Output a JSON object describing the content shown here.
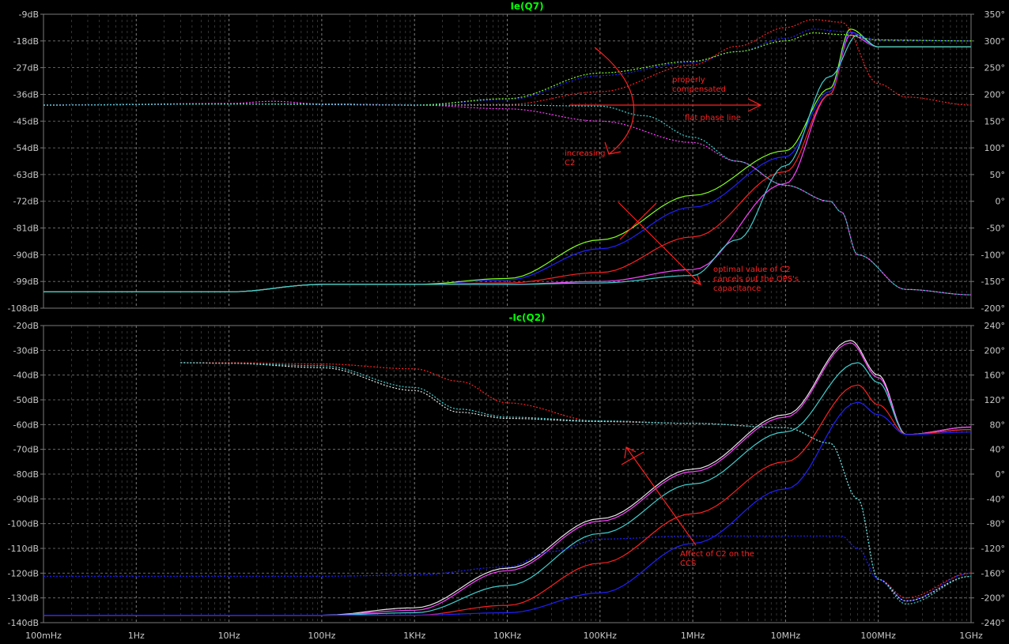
{
  "colors": {
    "background": "#000000",
    "grid": "#7a7a7a",
    "axis_text": "#c8c8c8",
    "title": "#00ff00",
    "annotation": "#ff2020",
    "magenta": "#ff40ff",
    "white": "#e8e8e8",
    "cyan": "#40d0d0",
    "red": "#ff2020",
    "blue": "#2020ff",
    "green": "#80ff20",
    "yellow": "#e8e830"
  },
  "x_axis": {
    "type": "log",
    "range_hz": [
      0.1,
      1000000000
    ],
    "tick_labels": [
      "100mHz",
      "1Hz",
      "10Hz",
      "100Hz",
      "1KHz",
      "10KHz",
      "100KHz",
      "1MHz",
      "10MHz",
      "100MHz",
      "1GHz"
    ]
  },
  "chart_data": [
    {
      "type": "line",
      "title": "Ie(Q7)",
      "x_scale": "log",
      "ylim_db": [
        -108,
        -9
      ],
      "ylim_deg": [
        -200,
        350
      ],
      "y_left_ticks": [
        "-9dB",
        "-18dB",
        "-27dB",
        "-36dB",
        "-45dB",
        "-54dB",
        "-63dB",
        "-72dB",
        "-81dB",
        "-90dB",
        "-99dB",
        "-108dB"
      ],
      "y_right_ticks": [
        "350°",
        "300°",
        "250°",
        "200°",
        "150°",
        "100°",
        "50°",
        "0°",
        "-50°",
        "-100°",
        "-150°",
        "-200°"
      ],
      "grid": true,
      "series": [
        {
          "color": "magenta",
          "kind": "magnitude",
          "x": [
            0.1,
            10,
            100,
            1000,
            10000,
            100000,
            1000000,
            10000000,
            30000000,
            50000000,
            100000000,
            1000000000
          ],
          "y": [
            -102.5,
            -102.5,
            -100,
            -100,
            -100,
            -99,
            -95,
            -66,
            -36,
            -16,
            -20,
            -20
          ]
        },
        {
          "color": "red",
          "kind": "magnitude",
          "x": [
            0.1,
            10,
            100,
            1000,
            10000,
            100000,
            1000000,
            10000000,
            30000000,
            50000000,
            100000000,
            1000000000
          ],
          "y": [
            -102.5,
            -102.5,
            -100,
            -100,
            -99.5,
            -96,
            -84,
            -62,
            -36,
            -15,
            -20,
            -20
          ]
        },
        {
          "color": "blue",
          "kind": "magnitude",
          "x": [
            0.1,
            10,
            100,
            1000,
            10000,
            100000,
            1000000,
            10000000,
            30000000,
            50000000,
            100000000,
            1000000000
          ],
          "y": [
            -102.5,
            -102.5,
            -100,
            -100,
            -98.5,
            -88,
            -74,
            -57,
            -35,
            -15,
            -20,
            -20
          ]
        },
        {
          "color": "green",
          "kind": "magnitude",
          "x": [
            0.1,
            10,
            100,
            1000,
            10000,
            100000,
            1000000,
            10000000,
            30000000,
            50000000,
            100000000,
            1000000000
          ],
          "y": [
            -102.5,
            -102.5,
            -100,
            -100,
            -98,
            -85,
            -70,
            -55,
            -34,
            -14,
            -20,
            -20
          ]
        },
        {
          "color": "cyan",
          "kind": "magnitude",
          "x": [
            0.1,
            10,
            100,
            1000,
            10000,
            100000,
            1000000,
            3000000,
            10000000,
            30000000,
            60000000,
            100000000,
            1000000000
          ],
          "y": [
            -102.5,
            -102.5,
            -100,
            -100,
            -100,
            -99.5,
            -97,
            -85,
            -60,
            -30,
            -16,
            -20,
            -20
          ]
        },
        {
          "color": "red",
          "kind": "phase",
          "x": [
            0.1,
            10,
            100,
            1000,
            10000,
            100000,
            1000000,
            3000000,
            10000000,
            20000000,
            40000000,
            100000000,
            200000000,
            1000000000
          ],
          "y": [
            180,
            182,
            182,
            180,
            181,
            205,
            255,
            290,
            325,
            340,
            335,
            220,
            195,
            180
          ]
        },
        {
          "color": "blue",
          "kind": "phase",
          "x": [
            0.1,
            10,
            100,
            1000,
            10000,
            100000,
            1000000,
            3000000,
            10000000,
            20000000,
            40000000,
            100000000,
            1000000000
          ],
          "y": [
            180,
            182,
            182,
            180,
            190,
            235,
            260,
            280,
            305,
            322,
            318,
            302,
            300
          ]
        },
        {
          "color": "green",
          "kind": "phase",
          "x": [
            0.1,
            10,
            100,
            1000,
            10000,
            100000,
            1000000,
            3000000,
            10000000,
            20000000,
            40000000,
            100000000,
            1000000000
          ],
          "y": [
            180,
            182,
            182,
            180,
            192,
            240,
            262,
            280,
            300,
            315,
            312,
            302,
            300
          ]
        },
        {
          "color": "magenta",
          "kind": "phase",
          "x": [
            0.1,
            10,
            30,
            100,
            1000,
            10000,
            100000,
            1000000,
            3000000,
            10000000,
            30000000,
            40000000,
            60000000,
            200000000,
            1000000000
          ],
          "y": [
            180,
            183,
            187,
            182,
            180,
            173,
            150,
            110,
            75,
            30,
            0,
            -20,
            -100,
            -165,
            -175
          ]
        },
        {
          "color": "cyan",
          "kind": "phase",
          "x": [
            0.1,
            10,
            1000,
            10000,
            100000,
            300000,
            1000000,
            3000000,
            10000000,
            30000000,
            40000000,
            60000000,
            200000000,
            1000000000
          ],
          "y": [
            180,
            182,
            180,
            180,
            178,
            160,
            120,
            75,
            30,
            0,
            -20,
            -100,
            -165,
            -175
          ]
        }
      ],
      "annotations": [
        "properly\ncompensated",
        "flat phase line",
        "increasing\nC2",
        "optimal value of C2\ncancels out the OPS's\ncapacitance"
      ]
    },
    {
      "type": "line",
      "title": "-Ic(Q2)",
      "x_scale": "log",
      "ylim_db": [
        -140,
        -20
      ],
      "ylim_deg": [
        -240,
        240
      ],
      "y_left_ticks": [
        "-20dB",
        "-30dB",
        "-40dB",
        "-50dB",
        "-60dB",
        "-70dB",
        "-80dB",
        "-90dB",
        "-100dB",
        "-110dB",
        "-120dB",
        "-130dB",
        "-140dB"
      ],
      "y_right_ticks": [
        "240°",
        "200°",
        "160°",
        "120°",
        "80°",
        "40°",
        "0°",
        "-40°",
        "-80°",
        "-120°",
        "-160°",
        "-200°",
        "-240°"
      ],
      "grid": true,
      "series": [
        {
          "color": "white",
          "kind": "magnitude",
          "x": [
            0.1,
            100,
            1000,
            10000,
            100000,
            1000000,
            10000000,
            50000000,
            100000000,
            200000000,
            1000000000
          ],
          "y": [
            -137,
            -137,
            -134,
            -118,
            -98,
            -78,
            -56,
            -26,
            -40,
            -64,
            -61
          ]
        },
        {
          "color": "magenta",
          "kind": "magnitude",
          "x": [
            0.1,
            100,
            1000,
            10000,
            100000,
            1000000,
            10000000,
            50000000,
            100000000,
            200000000,
            1000000000
          ],
          "y": [
            -137,
            -137,
            -135,
            -119,
            -99,
            -79,
            -57,
            -27,
            -41,
            -64,
            -61
          ]
        },
        {
          "color": "cyan",
          "kind": "magnitude",
          "x": [
            0.1,
            100,
            1000,
            10000,
            100000,
            1000000,
            10000000,
            60000000,
            100000000,
            200000000,
            1000000000
          ],
          "y": [
            -137,
            -137,
            -136,
            -125,
            -104,
            -84,
            -63,
            -35,
            -43,
            -64,
            -62
          ]
        },
        {
          "color": "red",
          "kind": "magnitude",
          "x": [
            0.1,
            100,
            1000,
            10000,
            100000,
            1000000,
            10000000,
            60000000,
            100000000,
            200000000,
            1000000000
          ],
          "y": [
            -137,
            -137,
            -137,
            -133,
            -116,
            -96,
            -75,
            -44,
            -52,
            -64,
            -62
          ]
        },
        {
          "color": "blue",
          "kind": "magnitude",
          "x": [
            0.1,
            100,
            1000,
            10000,
            100000,
            1000000,
            10000000,
            60000000,
            100000000,
            200000000,
            1000000000
          ],
          "y": [
            -137,
            -137,
            -137,
            -136,
            -128,
            -108,
            -86,
            -51,
            -56,
            -64,
            -63
          ]
        },
        {
          "color": "red",
          "kind": "phase",
          "x": [
            3,
            10,
            100,
            1000,
            3000,
            10000,
            100000,
            1000000,
            10000000,
            30000000,
            60000000,
            100000000,
            200000000,
            1000000000
          ],
          "y": [
            180,
            180,
            178,
            170,
            150,
            115,
            85,
            82,
            75,
            50,
            -40,
            -170,
            -200,
            -160
          ]
        },
        {
          "color": "white",
          "kind": "phase",
          "x": [
            3,
            10,
            100,
            1000,
            3000,
            10000,
            100000,
            1000000,
            10000000,
            30000000,
            60000000,
            100000000,
            200000000,
            1000000000
          ],
          "y": [
            180,
            179,
            172,
            135,
            100,
            90,
            85,
            82,
            75,
            50,
            -40,
            -170,
            -205,
            -165
          ]
        },
        {
          "color": "cyan",
          "kind": "phase",
          "x": [
            3,
            10,
            100,
            1000,
            3000,
            10000,
            100000,
            1000000,
            10000000,
            30000000,
            60000000,
            100000000,
            200000000,
            1000000000
          ],
          "y": [
            180,
            179,
            175,
            140,
            105,
            92,
            86,
            82,
            75,
            50,
            -40,
            -170,
            -210,
            -165
          ]
        },
        {
          "color": "blue",
          "kind": "phase",
          "x": [
            0.1,
            10,
            100,
            1000,
            10000,
            30000,
            100000,
            1000000,
            10000000,
            40000000,
            60000000,
            100000000,
            200000000,
            1000000000
          ],
          "y": [
            -165,
            -165,
            -165,
            -163,
            -150,
            -125,
            -105,
            -100,
            -100,
            -100,
            -120,
            -170,
            -205,
            -160
          ]
        }
      ],
      "annotations": [
        "Affect of C2 on the\nCCS"
      ]
    }
  ]
}
